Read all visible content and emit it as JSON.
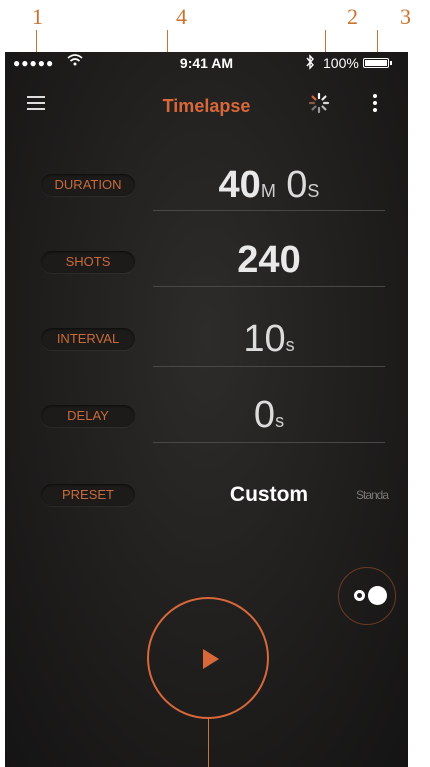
{
  "annotations": [
    "1",
    "4",
    "2",
    "3"
  ],
  "status_bar": {
    "signal": "●●●●●",
    "time": "9:41 AM",
    "battery": "100%"
  },
  "header": {
    "title": "Timelapse"
  },
  "fields": {
    "duration": {
      "label": "DURATION",
      "minutes": "40",
      "minutes_unit": "M",
      "seconds": "0",
      "seconds_unit": "S"
    },
    "shots": {
      "label": "SHOTS",
      "value": "240"
    },
    "interval": {
      "label": "INTERVAL",
      "value": "10",
      "unit": "s"
    },
    "delay": {
      "label": "DELAY",
      "value": "0",
      "unit": "s"
    },
    "preset": {
      "label": "PRESET",
      "value": "Custom",
      "next": "Standa"
    }
  },
  "icons": {
    "menu": "hamburger-icon",
    "spinner": "spinner-icon",
    "more": "kebab-icon",
    "play": "play-icon",
    "toggle": "dots-toggle-icon",
    "wifi": "wifi-icon",
    "bluetooth": "bluetooth-icon"
  },
  "colors": {
    "accent": "#d8673a",
    "background": "#1e1d1c",
    "text": "#e9e9e9"
  }
}
